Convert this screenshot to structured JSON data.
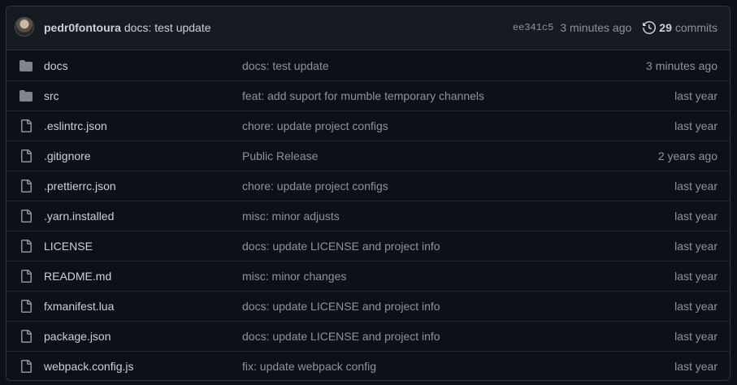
{
  "latest_commit": {
    "author": "pedr0fontoura",
    "message": "docs: test update",
    "sha": "ee341c5",
    "age": "3 minutes ago",
    "commit_count": "29",
    "commits_label": "commits"
  },
  "files": [
    {
      "type": "folder",
      "name": "docs",
      "message": "docs: test update",
      "age": "3 minutes ago"
    },
    {
      "type": "folder",
      "name": "src",
      "message": "feat: add suport for mumble temporary channels",
      "age": "last year"
    },
    {
      "type": "file",
      "name": ".eslintrc.json",
      "message": "chore: update project configs",
      "age": "last year"
    },
    {
      "type": "file",
      "name": ".gitignore",
      "message": "Public Release",
      "age": "2 years ago"
    },
    {
      "type": "file",
      "name": ".prettierrc.json",
      "message": "chore: update project configs",
      "age": "last year"
    },
    {
      "type": "file",
      "name": ".yarn.installed",
      "message": "misc: minor adjusts",
      "age": "last year"
    },
    {
      "type": "file",
      "name": "LICENSE",
      "message": "docs: update LICENSE and project info",
      "age": "last year"
    },
    {
      "type": "file",
      "name": "README.md",
      "message": "misc: minor changes",
      "age": "last year"
    },
    {
      "type": "file",
      "name": "fxmanifest.lua",
      "message": "docs: update LICENSE and project info",
      "age": "last year"
    },
    {
      "type": "file",
      "name": "package.json",
      "message": "docs: update LICENSE and project info",
      "age": "last year"
    },
    {
      "type": "file",
      "name": "webpack.config.js",
      "message": "fix: update webpack config",
      "age": "last year"
    }
  ],
  "icons": {
    "folder": "folder-icon",
    "file": "file-icon",
    "history": "history-icon"
  },
  "colors": {
    "background": "#0d1117",
    "header_background": "#161b22",
    "border": "#30363d",
    "text": "#c9d1d9",
    "muted": "#8b949e",
    "folder_icon": "#7d8590"
  }
}
